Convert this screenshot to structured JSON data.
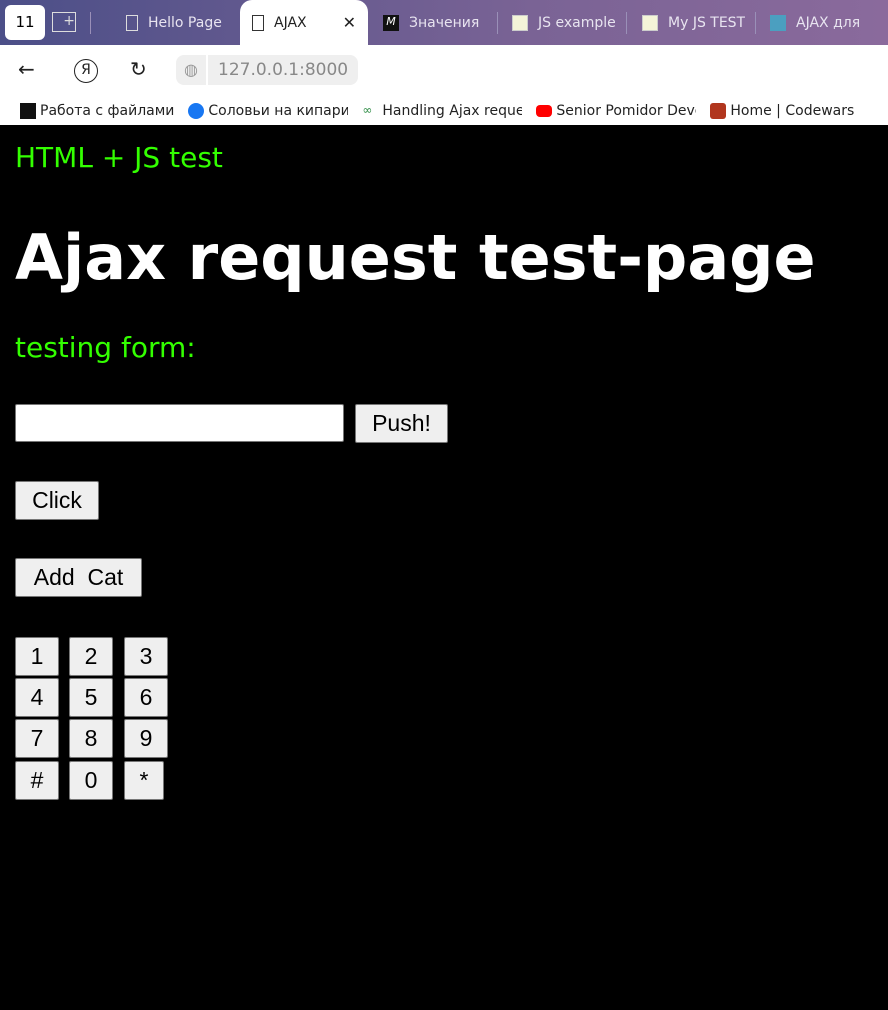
{
  "browser": {
    "tabs_count": "11",
    "tabs": [
      {
        "title": "Hello Page",
        "icon": "page-icon"
      },
      {
        "title": "AJAX",
        "icon": "page-icon",
        "active": true
      },
      {
        "title": "Значения",
        "icon": "m-logo-icon"
      },
      {
        "title": "JS example",
        "icon": "notepad-icon"
      },
      {
        "title": "My JS TEST",
        "icon": "notepad-icon"
      },
      {
        "title": "AJAX для",
        "icon": "splat-icon"
      }
    ],
    "url": "127.0.0.1:8000",
    "bookmarks": [
      {
        "label": "Работа с файлами",
        "icon": "m-logo-icon"
      },
      {
        "label": "Соловьи на кипарисах",
        "icon": "facebook-icon"
      },
      {
        "label": "Handling Ajax requests",
        "icon": "geeks-icon"
      },
      {
        "label": "Senior Pomidor Developer",
        "icon": "youtube-icon"
      },
      {
        "label": "Home | Codewars",
        "icon": "codewars-icon"
      }
    ]
  },
  "page": {
    "header": "HTML + JS test",
    "title": "Ajax request test-page",
    "form_label": "testing form:",
    "input_value": "",
    "push_label": "Push!",
    "click_label": "Click",
    "add_cat_label": "Add  Cat",
    "keypad": [
      "1",
      "2",
      "3",
      "4",
      "5",
      "6",
      "7",
      "8",
      "9",
      "#",
      "0",
      "*"
    ]
  },
  "colors": {
    "accent": "#33ff00",
    "background": "#000000"
  }
}
